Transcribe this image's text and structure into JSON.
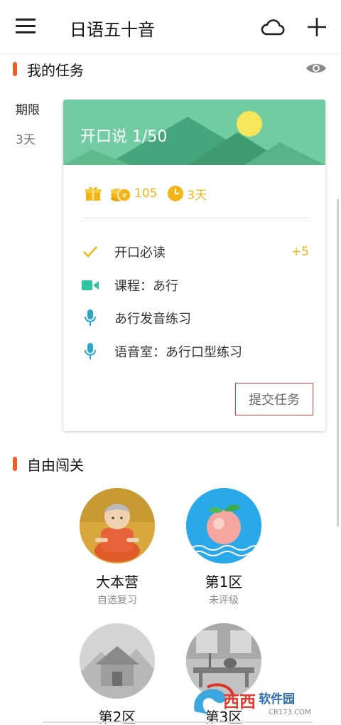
{
  "app": {
    "title": "日语五十音"
  },
  "toolbar": {
    "menu_icon": "hamburger-icon",
    "cloud_icon": "cloud-icon",
    "add_icon": "plus-icon"
  },
  "tasks_section": {
    "title": "我的任务",
    "visibility_icon": "eye-icon",
    "deadline_label": "期限",
    "deadline_value": "3天"
  },
  "task_card": {
    "title": "开口说 1/50",
    "stats": {
      "coins": "105",
      "days": "3天"
    },
    "items": [
      {
        "label": "开口必读",
        "icon": "check-icon",
        "points": "+5"
      },
      {
        "label": "课程：あ行",
        "icon": "video-camera-icon"
      },
      {
        "label": "あ行发音练习",
        "icon": "microphone-icon"
      },
      {
        "label": "语音室：あ行口型练习",
        "icon": "microphone-icon"
      }
    ],
    "submit_label": "提交任务"
  },
  "free_section": {
    "title": "自由闯关",
    "levels": [
      {
        "name": "大本营",
        "sub": "自选复习"
      },
      {
        "name": "第1区",
        "sub": "未评级"
      },
      {
        "name": "第2区",
        "sub": ""
      },
      {
        "name": "第3区",
        "sub": ""
      }
    ]
  },
  "watermark": {
    "text": "西西软件园",
    "sub": "CR173.COM"
  },
  "colors": {
    "accent": "#f15a2b",
    "gold": "#f3b515",
    "banner_green": "#6fcba0",
    "teal": "#2ec4a0",
    "mic_blue": "#2aa7c9",
    "submit_border": "#e23b3b"
  }
}
